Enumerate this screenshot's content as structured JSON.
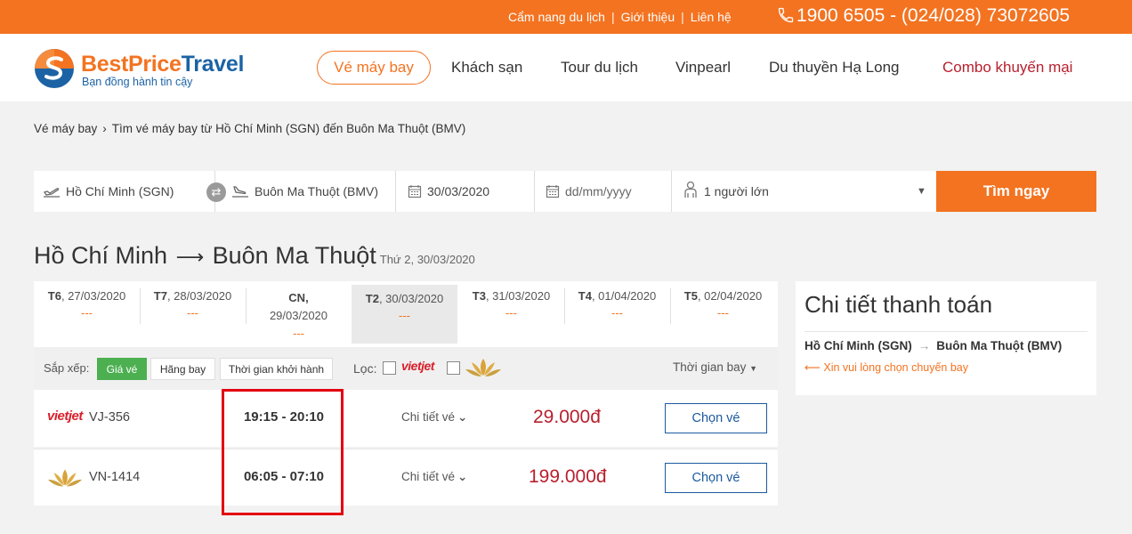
{
  "topbar": {
    "links": [
      "Cẩm nang du lịch",
      "Giới thiệu",
      "Liên hệ"
    ],
    "phone": "1900 6505 - (024/028) 73072605"
  },
  "brand": {
    "name_a": "BestPrice",
    "name_b": "Travel",
    "tagline": "Bạn đồng hành tin cậy"
  },
  "nav": {
    "active": "Vé máy bay",
    "items": [
      "Khách sạn",
      "Tour du lịch",
      "Vinpearl",
      "Du thuyền Hạ Long"
    ],
    "combo": "Combo khuyến mại"
  },
  "breadcrumb": {
    "home": "Vé máy bay",
    "current": "Tìm vé máy bay từ Hồ Chí Minh (SGN) đến Buôn Ma Thuột (BMV)"
  },
  "search": {
    "from": "Hồ Chí Minh (SGN)",
    "to": "Buôn Ma Thuột (BMV)",
    "depart": "30/03/2020",
    "return_placeholder": "dd/mm/yyyy",
    "passengers": "1 người lớn",
    "button": "Tìm ngay"
  },
  "route": {
    "from": "Hồ Chí Minh",
    "arrow": "⟶",
    "to": "Buôn Ma Thuột",
    "date": "Thứ 2, 30/03/2020"
  },
  "date_tabs": [
    {
      "day": "T6",
      "date": ", 27/03/2020",
      "price": "---"
    },
    {
      "day": "T7",
      "date": ", 28/03/2020",
      "price": "---"
    },
    {
      "day": "CN,",
      "date": "29/03/2020",
      "price": "---"
    },
    {
      "day": "T2",
      "date": ", 30/03/2020",
      "price": "---"
    },
    {
      "day": "T3",
      "date": ", 31/03/2020",
      "price": "---"
    },
    {
      "day": "T4",
      "date": ", 01/04/2020",
      "price": "---"
    },
    {
      "day": "T5",
      "date": ", 02/04/2020",
      "price": "---"
    }
  ],
  "sort": {
    "label": "Sắp xếp:",
    "options": [
      "Giá vé",
      "Hãng bay",
      "Thời gian khởi hành"
    ],
    "filter_label": "Lọc:",
    "airline_vj": "vietjet",
    "time_sort": "Thời gian bay"
  },
  "flights": [
    {
      "airline": "vietjet",
      "code": "VJ-356",
      "time": "19:15 - 20:10",
      "detail": "Chi tiết vé",
      "price": "29.000đ",
      "button": "Chọn vé"
    },
    {
      "airline": "vietnam-airlines",
      "code": "VN-1414",
      "time": "06:05 - 07:10",
      "detail": "Chi tiết vé",
      "price": "199.000đ",
      "button": "Chọn vé"
    }
  ],
  "sidebar": {
    "title": "Chi tiết thanh toán",
    "from": "Hồ Chí Minh (SGN)",
    "arrow": "→",
    "to": "Buôn Ma Thuột (BMV)",
    "message": "⟵ Xin vui lòng chọn chuyến bay"
  },
  "colors": {
    "brand_orange": "#f37321",
    "brand_blue": "#1c63a5",
    "price_red": "#b8202e",
    "active_green": "#4caf50",
    "highlight_red": "#e3000f"
  }
}
